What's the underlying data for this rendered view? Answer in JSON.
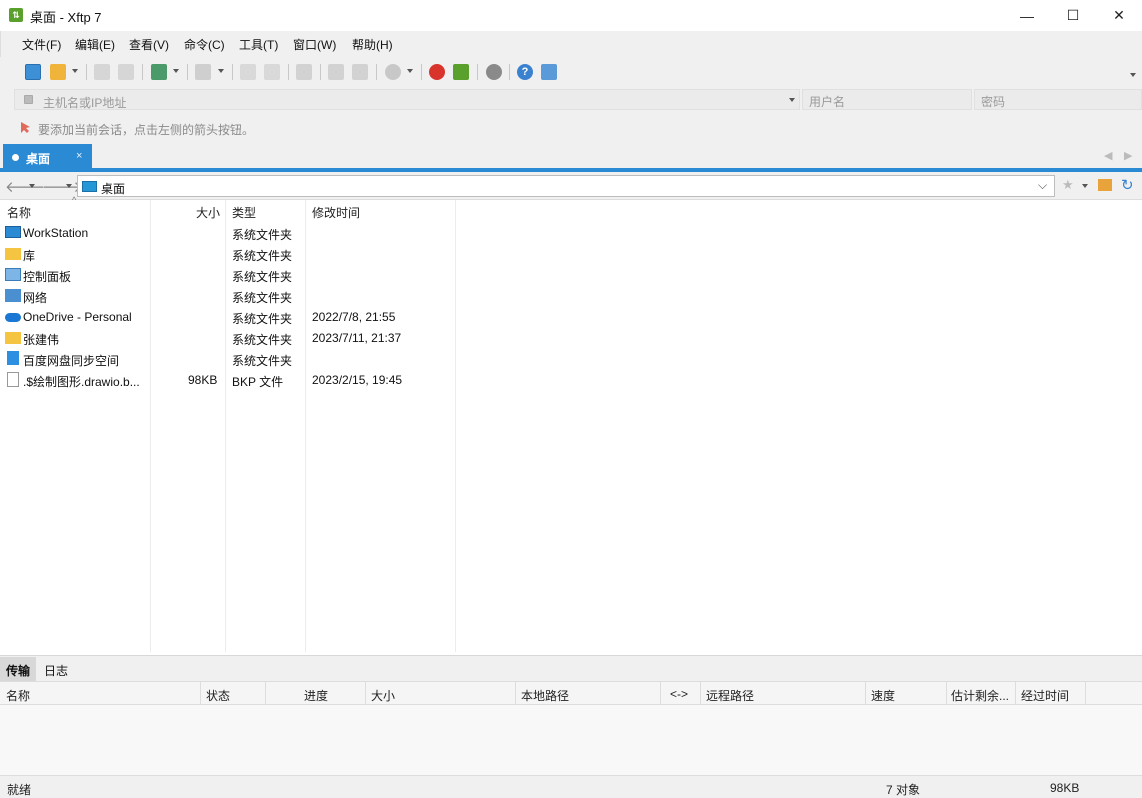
{
  "window": {
    "title": "桌面 - Xftp 7",
    "minimize": "—",
    "maximize": "☐",
    "close": "✕"
  },
  "menu": [
    "文件(F)",
    "编辑(E)",
    "查看(V)",
    "命令(C)",
    "工具(T)",
    "窗口(W)",
    "帮助(H)"
  ],
  "address": {
    "host_placeholder": "主机名或IP地址",
    "user_placeholder": "用户名",
    "pass_placeholder": "密码"
  },
  "hint": "要添加当前会话，点击左侧的箭头按钮。",
  "tab": {
    "label": "桌面",
    "close": "×"
  },
  "path": {
    "value": "桌面"
  },
  "columns": {
    "name": "名称",
    "size": "大小",
    "type": "类型",
    "modified": "修改时间"
  },
  "files": [
    {
      "name": "WorkStation",
      "size": "",
      "type": "系统文件夹",
      "modified": "",
      "icon": "computer-icon"
    },
    {
      "name": "库",
      "size": "",
      "type": "系统文件夹",
      "modified": "",
      "icon": "folder-icon"
    },
    {
      "name": "控制面板",
      "size": "",
      "type": "系统文件夹",
      "modified": "",
      "icon": "control-panel-icon"
    },
    {
      "name": "网络",
      "size": "",
      "type": "系统文件夹",
      "modified": "",
      "icon": "network-icon"
    },
    {
      "name": "OneDrive - Personal",
      "size": "",
      "type": "系统文件夹",
      "modified": "2022/7/8, 21:55",
      "icon": "cloud-icon"
    },
    {
      "name": "张建伟",
      "size": "",
      "type": "系统文件夹",
      "modified": "2023/7/11, 21:37",
      "icon": "folder-icon"
    },
    {
      "name": "百度网盘同步空间",
      "size": "",
      "type": "系统文件夹",
      "modified": "",
      "icon": "baidu-sync-icon"
    },
    {
      "name": ".$绘制图形.drawio.b...",
      "size": "98KB",
      "type": "BKP 文件",
      "modified": "2023/2/15, 19:45",
      "icon": "file-icon"
    }
  ],
  "transfer_tabs": [
    "传输",
    "日志"
  ],
  "transfer_columns": [
    "名称",
    "状态",
    "进度",
    "大小",
    "本地路径",
    "<->",
    "远程路径",
    "速度",
    "估计剩余...",
    "经过时间"
  ],
  "status": {
    "left": "就绪",
    "count": "7 对象",
    "size": "98KB"
  },
  "colors": {
    "accent": "#2a8ad4",
    "folder": "#f5c542",
    "app_icon": "#5aa02c"
  }
}
